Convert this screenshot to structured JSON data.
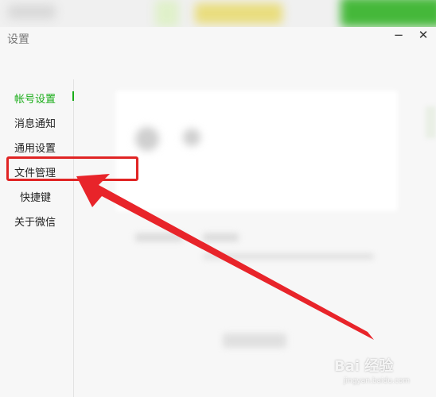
{
  "window": {
    "title": "设置",
    "minimize_glyph": "−",
    "close_glyph": "✕"
  },
  "sidebar": {
    "items": [
      {
        "label": "帐号设置",
        "active": true
      },
      {
        "label": "消息通知",
        "active": false
      },
      {
        "label": "通用设置",
        "active": false
      },
      {
        "label": "文件管理",
        "active": false,
        "highlighted": true
      },
      {
        "label": "快捷键",
        "active": false
      },
      {
        "label": "关于微信",
        "active": false
      }
    ]
  },
  "colors": {
    "accent_green": "#1aad19",
    "annotation_red": "#e02424"
  },
  "watermark": {
    "text": "Bai 经验",
    "sub": "jingyan.baidu.com"
  }
}
